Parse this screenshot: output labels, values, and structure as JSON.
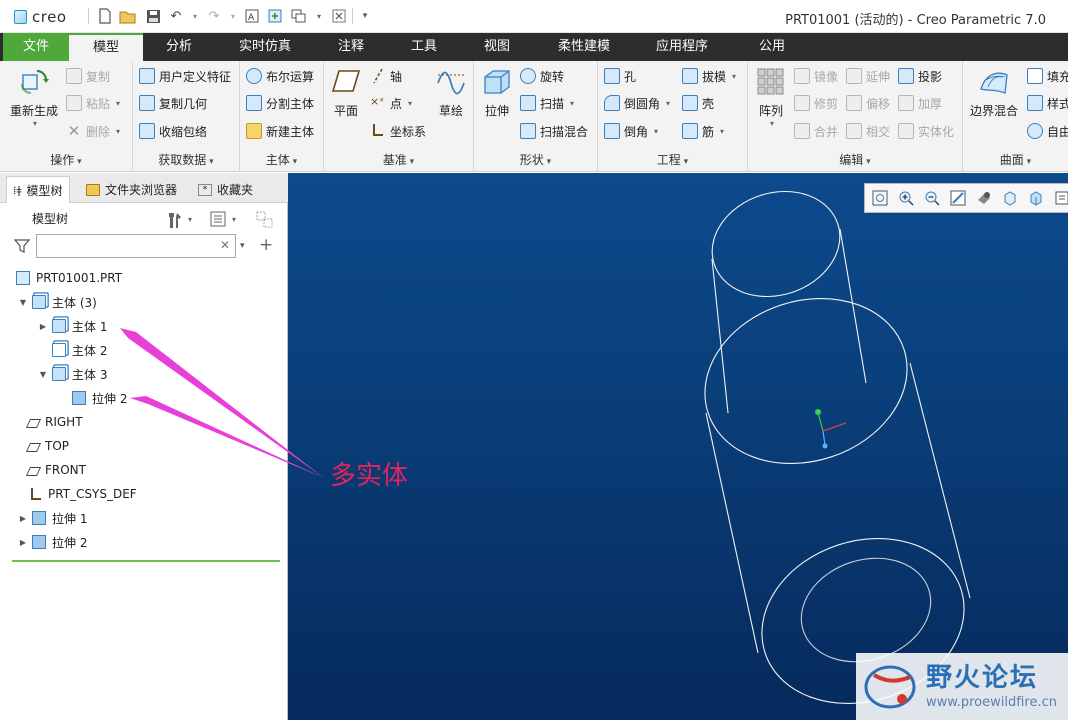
{
  "app": {
    "logo": "creo",
    "window_title": "PRT01001 (活动的) - Creo Parametric 7.0"
  },
  "tabs": [
    "文件",
    "模型",
    "分析",
    "实时仿真",
    "注释",
    "工具",
    "视图",
    "柔性建模",
    "应用程序",
    "公用"
  ],
  "active_tab": "模型",
  "ribbon": {
    "ops": {
      "label": "操作",
      "regen": "重新生成",
      "copy": "复制",
      "paste": "粘贴",
      "delete": "删除"
    },
    "get": {
      "label": "获取数据",
      "udf": "用户定义特征",
      "copygeom": "复制几何",
      "shrink": "收缩包络"
    },
    "body": {
      "label": "主体",
      "boolean": "布尔运算",
      "split": "分割主体",
      "new": "新建主体"
    },
    "datum": {
      "label": "基准",
      "plane": "平面",
      "axis": "轴",
      "point": "点",
      "csys": "坐标系",
      "sketch": "草绘"
    },
    "shape": {
      "label": "形状",
      "extrude": "拉伸",
      "revolve": "旋转",
      "sweep": "扫描",
      "sweepblend": "扫描混合"
    },
    "eng": {
      "label": "工程",
      "hole": "孔",
      "draft": "拔模",
      "round": "倒圆角",
      "shell": "壳",
      "chamfer": "倒角",
      "rib": "筋"
    },
    "edit": {
      "label": "编辑",
      "pattern": "阵列",
      "mirror": "镜像",
      "extend": "延伸",
      "project": "投影",
      "trim": "修剪",
      "offset": "偏移",
      "thicken": "加厚",
      "merge": "合并",
      "intersect": "相交",
      "solidify": "实体化"
    },
    "surf": {
      "label": "曲面",
      "boundary": "边界混合",
      "fill": "填充",
      "style": "样式",
      "free": "自由"
    }
  },
  "panel": {
    "tabs": [
      "模型树",
      "文件夹浏览器",
      "收藏夹"
    ],
    "tree_title": "模型树",
    "search_placeholder": "",
    "tree": [
      {
        "label": "PRT01001.PRT",
        "icon": "part-icon",
        "level": 0,
        "expander": ""
      },
      {
        "label": "主体 (3)",
        "icon": "bodies-icon",
        "level": 0,
        "expander": "▼"
      },
      {
        "label": "主体 1",
        "icon": "body-icon",
        "level": 1,
        "expander": "▶"
      },
      {
        "label": "主体 2",
        "icon": "body-icon",
        "level": 1,
        "expander": ""
      },
      {
        "label": "主体 3",
        "icon": "body-icon",
        "level": 1,
        "expander": "▼"
      },
      {
        "label": "拉伸 2",
        "icon": "extrude-icon",
        "level": 2,
        "expander": ""
      },
      {
        "label": "RIGHT",
        "icon": "datum-plane-icon",
        "level": 0,
        "expander": ""
      },
      {
        "label": "TOP",
        "icon": "datum-plane-icon",
        "level": 0,
        "expander": ""
      },
      {
        "label": "FRONT",
        "icon": "datum-plane-icon",
        "level": 0,
        "expander": ""
      },
      {
        "label": "PRT_CSYS_DEF",
        "icon": "csys-icon",
        "level": 0,
        "expander": ""
      },
      {
        "label": "拉伸 1",
        "icon": "extrude-icon",
        "level": 0,
        "expander": "▶"
      },
      {
        "label": "拉伸 2",
        "icon": "extrude-icon",
        "level": 0,
        "expander": "▶"
      }
    ]
  },
  "annotation": {
    "text": "多实体",
    "color": "#e0245e"
  },
  "watermark": {
    "title": "野火论坛",
    "url": "www.proewildfire.cn"
  },
  "colors": {
    "file_tab": "#4fa83a",
    "tab_bar": "#2d2d2d",
    "viewport": "#0a3f7a"
  }
}
